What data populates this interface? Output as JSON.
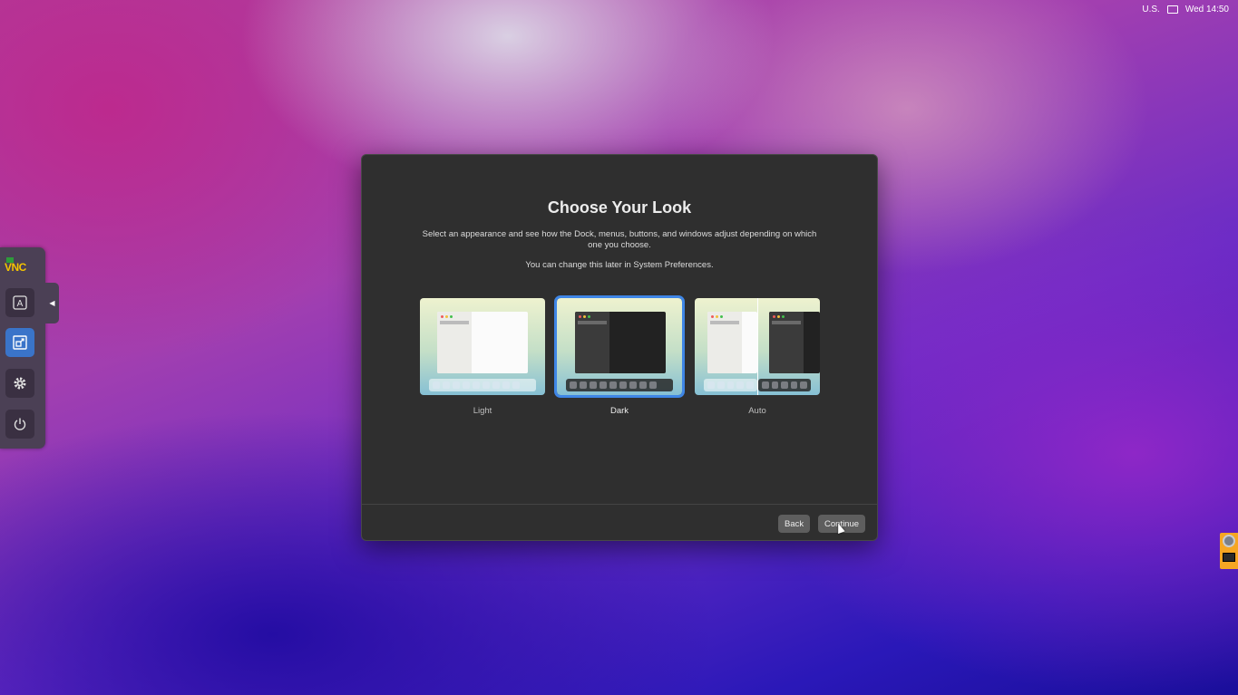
{
  "menubar": {
    "input_source": "U.S.",
    "clock": "Wed 14:50"
  },
  "vnc": {
    "logo": "VNC",
    "buttons": [
      {
        "name": "keyboard-button",
        "icon": "keyboard-a-icon"
      },
      {
        "name": "scaling-button",
        "icon": "scale-icon",
        "active": true
      },
      {
        "name": "settings-button",
        "icon": "gear-icon"
      },
      {
        "name": "power-button",
        "icon": "power-icon"
      }
    ]
  },
  "dialog": {
    "title": "Choose Your Look",
    "description": "Select an appearance and see how the Dock, menus, buttons, and windows adjust depending on which one you choose.",
    "note": "You can change this later in System Preferences.",
    "options": [
      {
        "label": "Light",
        "selected": false
      },
      {
        "label": "Dark",
        "selected": true
      },
      {
        "label": "Auto",
        "selected": false
      }
    ],
    "back_label": "Back",
    "continue_label": "Continue"
  },
  "colors": {
    "accent": "#3f86e6",
    "dialog_bg": "#2f2f2f",
    "vnc_logo": "#f5c400"
  }
}
